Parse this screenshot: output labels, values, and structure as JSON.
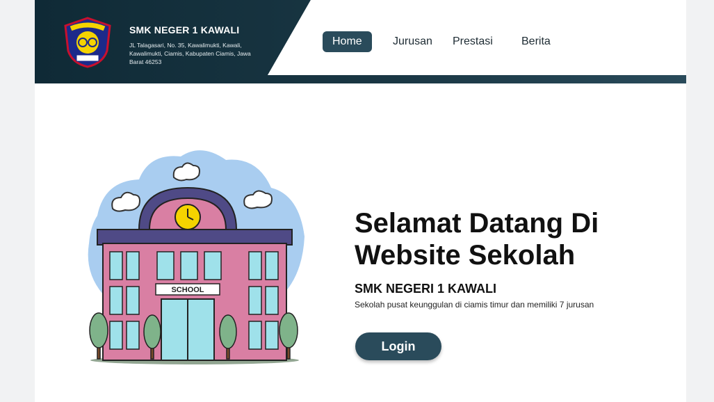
{
  "header": {
    "school_name": "SMK NEGER 1 KAWALI",
    "address": "JL Talagasari, No. 35, Kawalimukti, Kawali, Kawalimukti, Ciamis, Kabupaten Ciamis, Jawa Barat 46253",
    "logo_icon": "school-emblem-icon"
  },
  "nav": {
    "items": [
      {
        "label": "Home",
        "active": true
      },
      {
        "label": "Jurusan",
        "active": false
      },
      {
        "label": "Prestasi",
        "active": false
      },
      {
        "label": "Berita",
        "active": false
      }
    ]
  },
  "hero": {
    "title": "Selamat Datang Di Website Sekolah",
    "school": "SMK NEGERI 1 KAWALI",
    "description": "Sekolah pusat keunggulan di ciamis timur dan memiliki 7 jurusan",
    "login_label": "Login",
    "illustration_icon": "school-building-icon",
    "illustration_sign": "SCHOOL"
  },
  "colors": {
    "header_dark": "#1a3744",
    "accent": "#2a4b5b",
    "building": "#d97fa3",
    "roof": "#4f4a86",
    "sky": "#a9cdf0"
  }
}
